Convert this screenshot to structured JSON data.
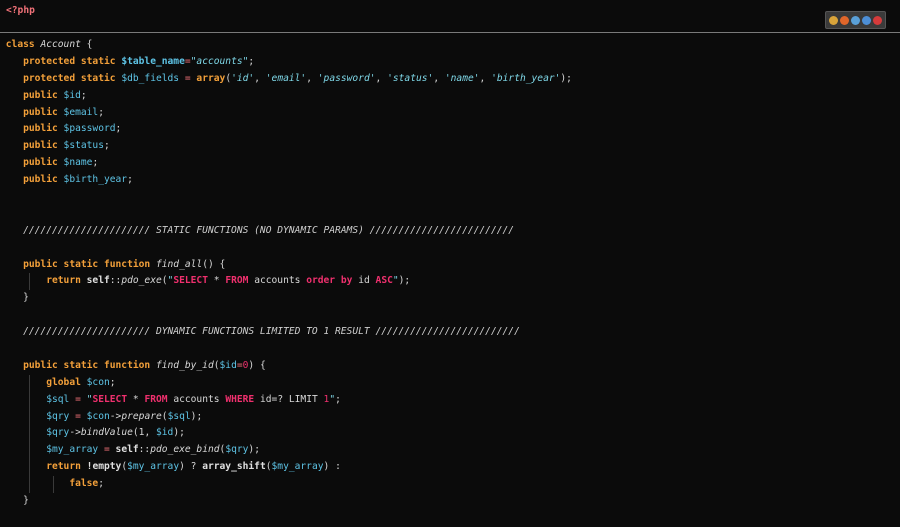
{
  "editor": {
    "php_open_tag": "<?php",
    "browser_icons": [
      {
        "name": "chrome-icon",
        "color": "#d9a43a"
      },
      {
        "name": "firefox-icon",
        "color": "#e0662a"
      },
      {
        "name": "safari-icon",
        "color": "#5aa0d8"
      },
      {
        "name": "ie-icon",
        "color": "#4d8fd6"
      },
      {
        "name": "opera-icon",
        "color": "#d53b3b"
      }
    ],
    "code": {
      "class_kw": "class",
      "class_name": "Account",
      "brace_open": " {",
      "protected_static": "protected static",
      "public": "public",
      "public_static_function": "public static function",
      "table_name_var": "$table_name",
      "table_name_value": "\"accounts\"",
      "db_fields_var": "$db_fields",
      "array_fn": "array",
      "db_fields_items": [
        "'id'",
        "'email'",
        "'password'",
        "'status'",
        "'name'",
        "'birth_year'"
      ],
      "props": [
        "$id",
        "$email",
        "$password",
        "$status",
        "$name",
        "$birth_year"
      ],
      "comment_static": "////////////////////// STATIC FUNCTIONS (NO DYNAMIC PARAMS) /////////////////////////",
      "comment_dynamic": "////////////////////// DYNAMIC FUNCTIONS LIMITED TO 1 RESULT /////////////////////////",
      "find_all": "find_all",
      "return_kw": "return",
      "self": "self",
      "pdo_exe": "pdo_exe",
      "sql_select": "SELECT",
      "sql_from": "FROM",
      "sql_accounts": "accounts",
      "sql_order_by": "order by",
      "sql_id": "id",
      "sql_asc": "ASC",
      "find_by_id": "find_by_id",
      "id_param": "$id",
      "default_zero": "0",
      "global_kw": "global",
      "con_var": "$con",
      "sql_var": "$sql",
      "sql_where": "WHERE",
      "sql_where_clause": "id=? LIMIT",
      "limit_one": "1",
      "qry_var": "$qry",
      "prepare_fn": "prepare",
      "bindvalue_fn": "bindValue",
      "bind_one": "1",
      "my_array_var": "$my_array",
      "pdo_exe_bind": "pdo_exe_bind",
      "empty_fn": "empty",
      "array_shift_fn": "array_shift",
      "false_kw": "false",
      "brace_close": "}"
    }
  }
}
